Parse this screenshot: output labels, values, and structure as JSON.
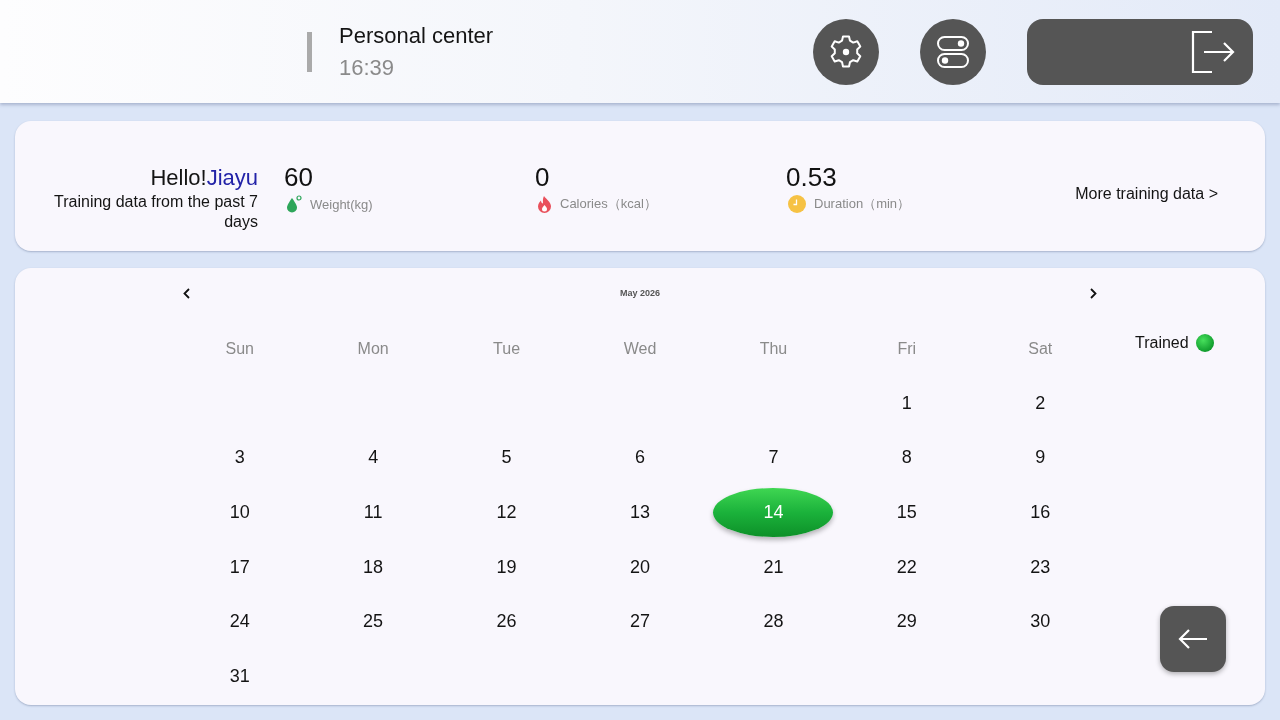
{
  "header": {
    "title": "Personal center",
    "time": "16:39"
  },
  "summary": {
    "greeting": "Hello!",
    "name": "Jiayu",
    "subtitle": "Training data from the past 7 days",
    "stats": [
      {
        "kind": "weight",
        "value": "60",
        "label": "Weight(kg)"
      },
      {
        "kind": "calories",
        "value": "0",
        "label": "Calories（kcal）"
      },
      {
        "kind": "duration",
        "value": "0.53",
        "label": "Duration（min）"
      }
    ],
    "more_link": "More training data >"
  },
  "calendar": {
    "month": "May 2026",
    "weekdays": [
      "Sun",
      "Mon",
      "Tue",
      "Wed",
      "Thu",
      "Fri",
      "Sat"
    ],
    "weeks": [
      {
        "days": [
          {
            "label": "1",
            "trained": false
          },
          {
            "label": "2",
            "trained": false
          }
        ]
      },
      {
        "days": [
          {
            "label": "3",
            "trained": false
          },
          {
            "label": "4",
            "trained": false
          },
          {
            "label": "5",
            "trained": false
          },
          {
            "label": "6",
            "trained": false
          },
          {
            "label": "7",
            "trained": false
          },
          {
            "label": "8",
            "trained": false
          },
          {
            "label": "9",
            "trained": false
          }
        ]
      },
      {
        "days": [
          {
            "label": "10",
            "trained": false
          },
          {
            "label": "11",
            "trained": false
          },
          {
            "label": "12",
            "trained": false
          },
          {
            "label": "13",
            "trained": false
          },
          {
            "label": "14",
            "trained": true
          },
          {
            "label": "15",
            "trained": false
          },
          {
            "label": "16",
            "trained": false
          }
        ]
      },
      {
        "days": [
          {
            "label": "17",
            "trained": false
          },
          {
            "label": "18",
            "trained": false
          },
          {
            "label": "19",
            "trained": false
          },
          {
            "label": "20",
            "trained": false
          },
          {
            "label": "21",
            "trained": false
          },
          {
            "label": "22",
            "trained": false
          },
          {
            "label": "23",
            "trained": false
          }
        ]
      },
      {
        "days": [
          {
            "label": "24",
            "trained": false
          },
          {
            "label": "25",
            "trained": false
          },
          {
            "label": "26",
            "trained": false
          },
          {
            "label": "27",
            "trained": false
          },
          {
            "label": "28",
            "trained": false
          },
          {
            "label": "29",
            "trained": false
          },
          {
            "label": "30",
            "trained": false
          }
        ]
      },
      {
        "days": [
          {
            "label": "31",
            "trained": false
          }
        ]
      }
    ],
    "legend": "Trained"
  }
}
